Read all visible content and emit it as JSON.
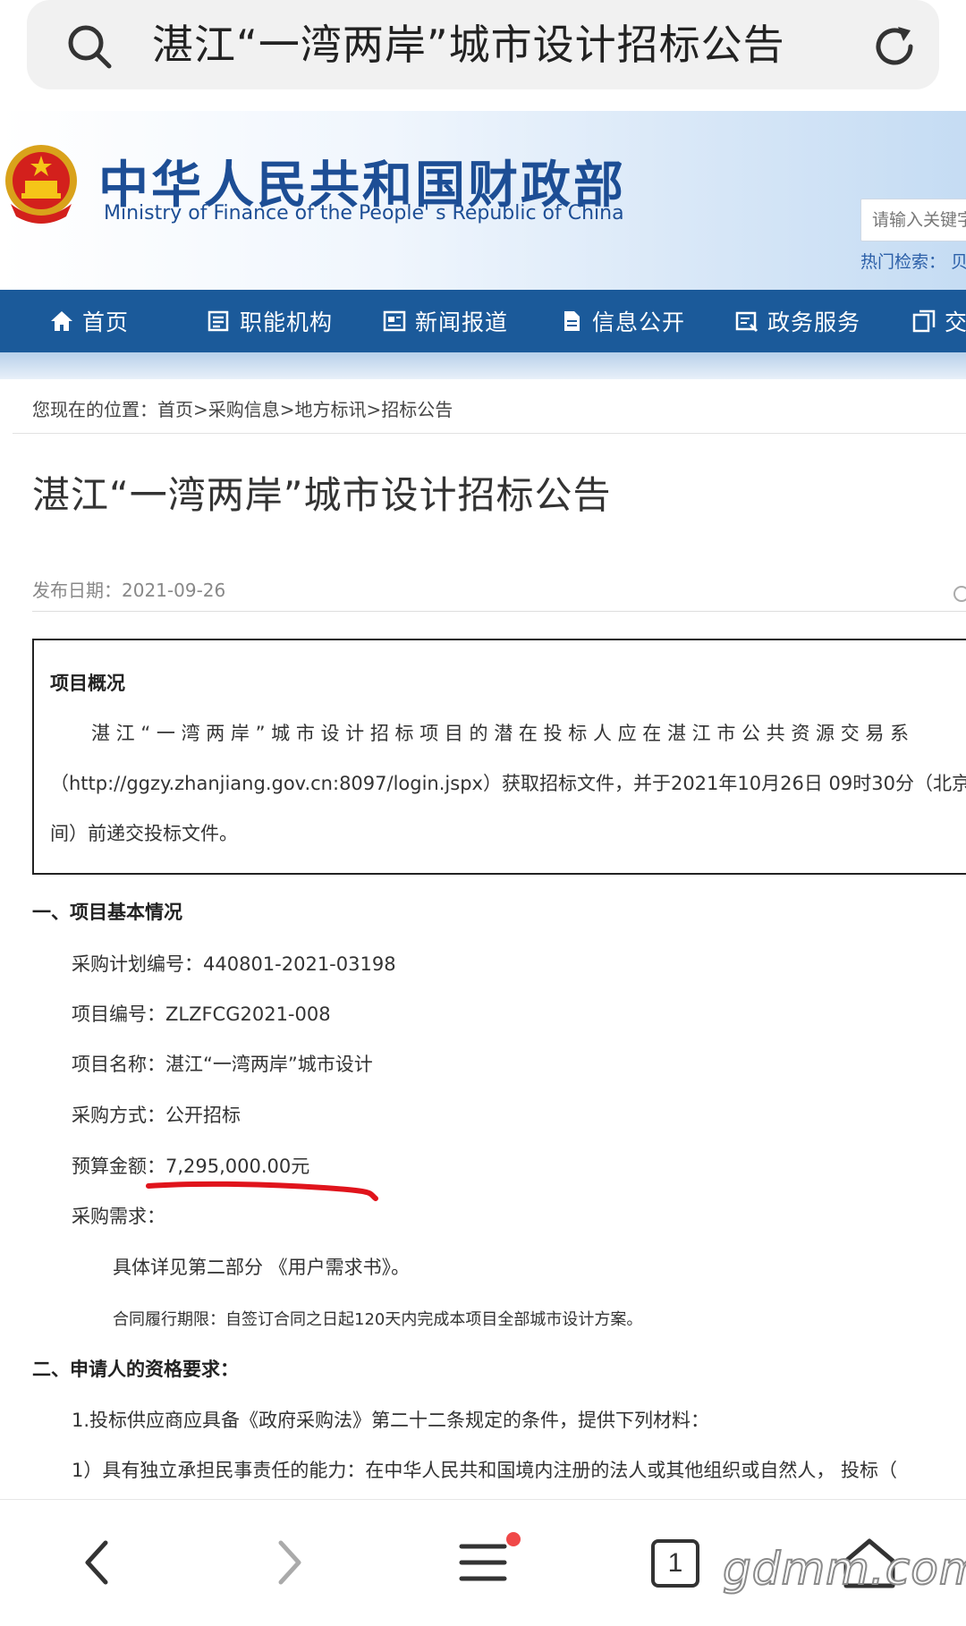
{
  "browser": {
    "address_text": "湛江“一湾两岸”城市设计招标公告",
    "tab_count": "1",
    "watermark": "gdmm.com"
  },
  "site": {
    "title_cn": "中华人民共和国财政部",
    "title_en": "Ministry of Finance of the People' s Republic of China",
    "search_placeholder": "请输入关键字",
    "hot_search_label": "热门检索：  贝"
  },
  "nav": [
    {
      "label": "首页",
      "icon": "home-icon"
    },
    {
      "label": "职能机构",
      "icon": "list-icon"
    },
    {
      "label": "新闻报道",
      "icon": "news-icon"
    },
    {
      "label": "信息公开",
      "icon": "document-icon"
    },
    {
      "label": "政务服务",
      "icon": "service-icon"
    },
    {
      "label": "交",
      "icon": "exchange-icon"
    }
  ],
  "breadcrumb": "您现在的位置：首页>采购信息>地方标讯>招标公告",
  "article": {
    "title": "湛江“一湾两岸”城市设计招标公告",
    "publish_date": "发布日期：2021-09-26",
    "summary_heading": "项目概况",
    "summary_lines": [
      "湛 江 “ 一 湾 两 岸 ” 城 市 设 计 招 标 项 目 的 潜 在 投 标 人 应 在 湛 江 市 公 共 资 源 交 易 系",
      "（http://ggzy.zhanjiang.gov.cn:8097/login.jspx）获取招标文件，并于2021年10月26日 09时30分（北京",
      "间）前递交投标文件。"
    ],
    "section1_heading": "一、项目基本情况",
    "plan_number": "采购计划编号：440801-2021-03198",
    "project_number": "项目编号：ZLZFCG2021-008",
    "project_name": "项目名称：湛江“一湾两岸”城市设计",
    "procurement_method": "采购方式：公开招标",
    "budget": "预算金额：7,295,000.00元",
    "requirement_label": "采购需求：",
    "requirement_detail": "具体详见第二部分 《用户需求书》。",
    "contract_period": "合同履行期限：自签订合同之日起120天内完成本项目全部城市设计方案。",
    "section2_heading": "二、申请人的资格要求：",
    "qualification_1": "1.投标供应商应具备《政府采购法》第二十二条规定的条件，提供下列材料：",
    "qualification_1_1": "1）具有独立承担民事责任的能力：在中华人民共和国境内注册的法人或其他组织或自然人， 投标（"
  },
  "colors": {
    "nav_bg": "#1b5a9a",
    "brand_blue": "#1d4e95",
    "annotation_red": "#e0141c",
    "notification_dot": "#f04848"
  }
}
